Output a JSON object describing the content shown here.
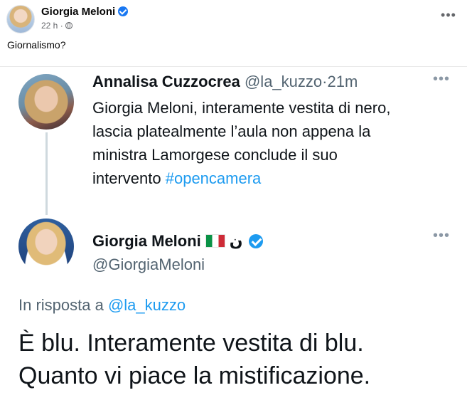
{
  "post": {
    "author": "Giorgia Meloni",
    "time": "22 h",
    "separator": "·",
    "more_icon": "more-horizontal-icon",
    "text": "Giornalismo?"
  },
  "tweet_original": {
    "name": "Annalisa Cuzzocrea",
    "handle": "@la_kuzzo",
    "dot": "·",
    "time": "21m",
    "lines": [
      "Giorgia Meloni, interamente vestita di nero,",
      "lascia platealmente l’aula non appena la",
      "ministra Lamorgese conclude il suo"
    ],
    "last_line_text": "intervento ",
    "hashtag": "#opencamera"
  },
  "tweet_reply": {
    "name": "Giorgia Meloni",
    "extra_glyph": "ن",
    "handle": "@GiorgiaMeloni",
    "reply_prefix": "In risposta a ",
    "reply_to": "@la_kuzzo",
    "lines": [
      "È blu. Interamente vestita di blu.",
      "Quanto vi piace la mistificazione."
    ]
  },
  "colors": {
    "facebook_blue": "#1877f2",
    "twitter_blue": "#1d9bf0",
    "muted_text": "#536471"
  }
}
